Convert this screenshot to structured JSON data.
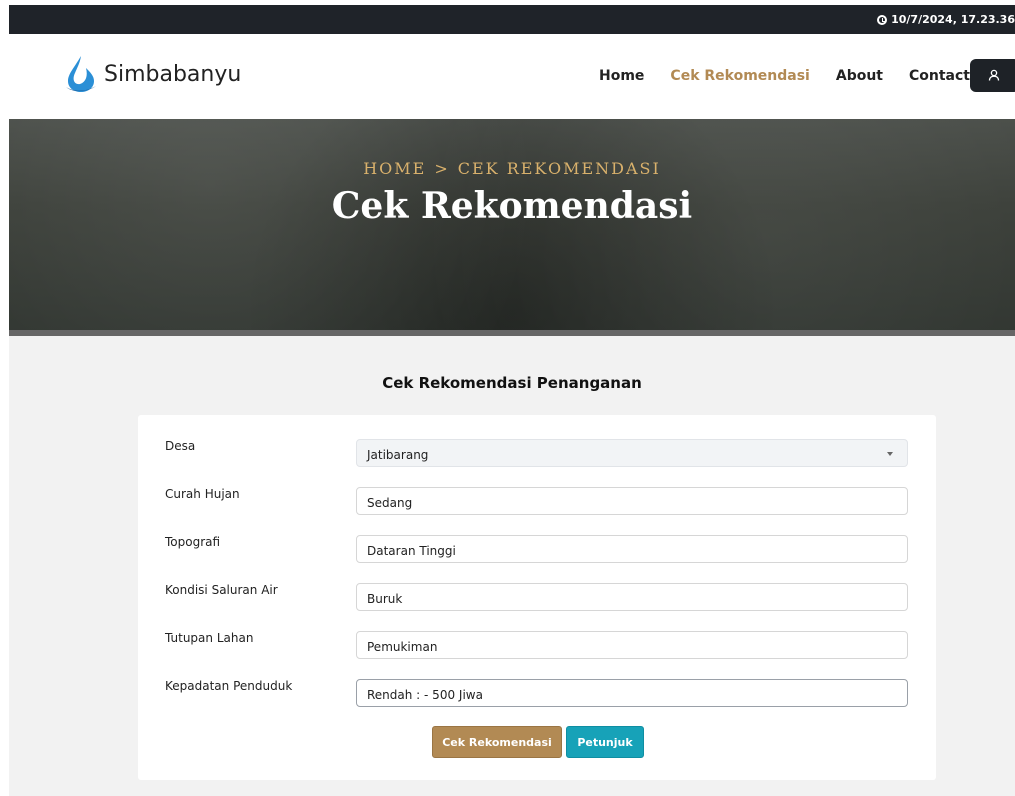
{
  "topbar": {
    "datetime": "10/7/2024, 17.23.36"
  },
  "brand": {
    "name": "Simbabanyu",
    "logo_icon": "water-drop-icon"
  },
  "nav": {
    "items": [
      {
        "label": "Home"
      },
      {
        "label": "Cek Rekomendasi",
        "active": true
      },
      {
        "label": "About"
      },
      {
        "label": "Contact"
      }
    ],
    "user_icon": "user-icon"
  },
  "hero": {
    "breadcrumb_home": "HOME",
    "breadcrumb_sep": ">",
    "breadcrumb_current": "CEK REKOMENDASI",
    "title": "Cek Rekomendasi"
  },
  "form": {
    "title": "Cek Rekomendasi Penanganan",
    "fields": [
      {
        "label": "Desa",
        "value": "Jatibarang"
      },
      {
        "label": "Curah Hujan",
        "value": "Sedang"
      },
      {
        "label": "Topografi",
        "value": "Dataran Tinggi"
      },
      {
        "label": "Kondisi Saluran Air",
        "value": "Buruk"
      },
      {
        "label": "Tutupan Lahan",
        "value": "Pemukiman"
      },
      {
        "label": "Kepadatan Penduduk",
        "value": "Rendah : - 500 Jiwa"
      }
    ],
    "submit_label": "Cek Rekomendasi",
    "help_label": "Petunjuk"
  },
  "colors": {
    "accent": "#b28a54",
    "info": "#17a2b8",
    "dark": "#1f2329"
  }
}
